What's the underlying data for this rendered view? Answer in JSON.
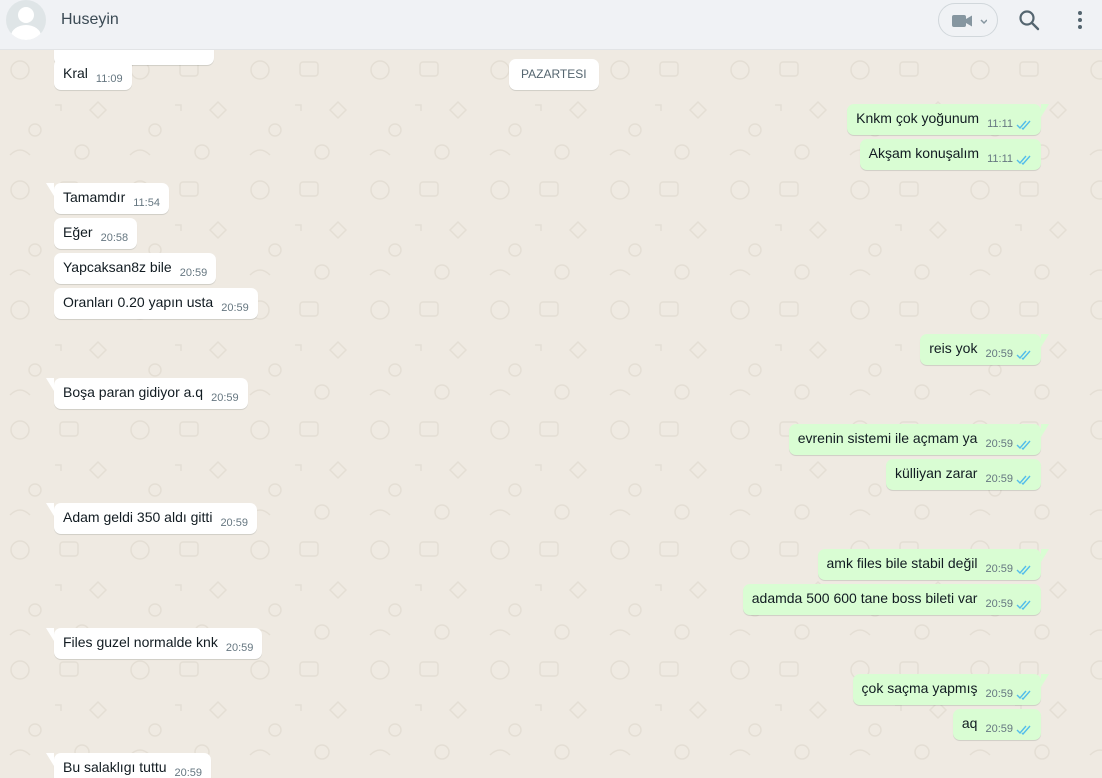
{
  "header": {
    "contact_name": "Huseyin",
    "icons": [
      "avatar",
      "video-call-icon",
      "chevron-down-icon",
      "search-icon",
      "menu-icon"
    ]
  },
  "chat": {
    "date_chip": "PAZARTESI",
    "colors": {
      "incoming_bg": "#ffffff",
      "outgoing_bg": "#d9fdd3",
      "tick_color": "#53bdeb",
      "wallpaper": "#efeae2"
    },
    "messages": [
      {
        "dir": "in",
        "text": "Kral",
        "time": "11:09"
      },
      {
        "dir": "out",
        "text": "Knkm çok yoğunum",
        "time": "11:11"
      },
      {
        "dir": "out",
        "text": "Akşam konuşalım",
        "time": "11:11"
      },
      {
        "dir": "in",
        "text": "Tamamdır",
        "time": "11:54"
      },
      {
        "dir": "in",
        "text": "Eğer",
        "time": "20:58"
      },
      {
        "dir": "in",
        "text": "Yapcaksan8z bile",
        "time": "20:59"
      },
      {
        "dir": "in",
        "text": "Oranları 0.20 yapın usta",
        "time": "20:59"
      },
      {
        "dir": "out",
        "text": "reis yok",
        "time": "20:59"
      },
      {
        "dir": "in",
        "text": "Boşa paran gidiyor a.q",
        "time": "20:59"
      },
      {
        "dir": "out",
        "text": "evrenin sistemi ile açmam ya",
        "time": "20:59"
      },
      {
        "dir": "out",
        "text": "külliyan zarar",
        "time": "20:59"
      },
      {
        "dir": "in",
        "text": "Adam geldi 350 aldı gitti",
        "time": "20:59"
      },
      {
        "dir": "out",
        "text": "amk files bile stabil değil",
        "time": "20:59"
      },
      {
        "dir": "out",
        "text": "adamda 500 600 tane boss bileti var",
        "time": "20:59"
      },
      {
        "dir": "in",
        "text": "Files guzel normalde knk",
        "time": "20:59"
      },
      {
        "dir": "out",
        "text": "çok saçma yapmış",
        "time": "20:59"
      },
      {
        "dir": "out",
        "text": "aq",
        "time": "20:59"
      },
      {
        "dir": "in",
        "text": "Bu  salaklıgı tuttu",
        "time": "20:59"
      }
    ]
  }
}
